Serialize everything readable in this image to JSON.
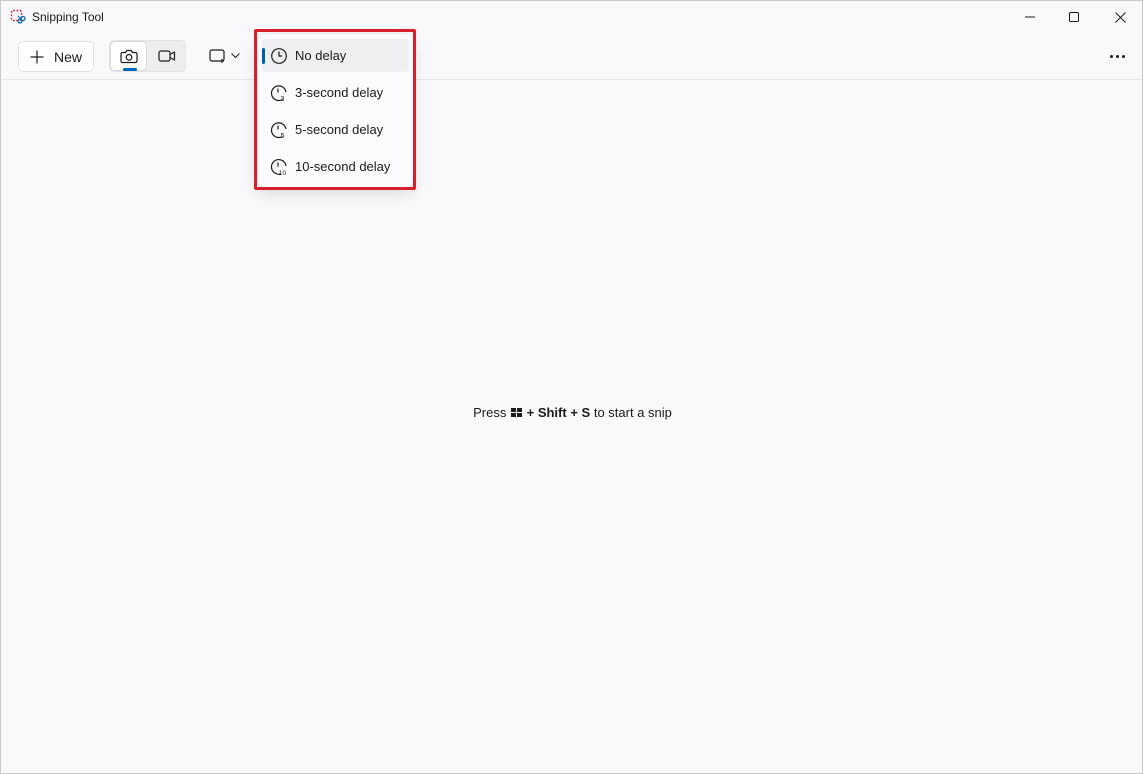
{
  "window": {
    "title": "Snipping Tool",
    "controls": {
      "minimize_icon": "minimize-icon",
      "maximize_icon": "maximize-icon",
      "close_icon": "close-icon"
    }
  },
  "toolbar": {
    "new_label": "New",
    "new_icon": "plus-icon",
    "modes": [
      {
        "name": "screenshot",
        "icon": "camera-icon",
        "selected": true
      },
      {
        "name": "record",
        "icon": "video-camera-icon",
        "selected": false
      }
    ],
    "shape_icon": "rectangle-snip-icon",
    "more_icon": "more-icon"
  },
  "delay_menu": {
    "items": [
      {
        "label": "No delay",
        "icon": "clock-icon",
        "selected": true
      },
      {
        "label": "3-second delay",
        "icon": "timer-3-icon",
        "selected": false
      },
      {
        "label": "5-second delay",
        "icon": "timer-5-icon",
        "selected": false
      },
      {
        "label": "10-second delay",
        "icon": "timer-10-icon",
        "selected": false
      }
    ]
  },
  "hint": {
    "prefix": "Press",
    "plus1": "+",
    "shift": "Shift",
    "plus2": "+",
    "s_key": "S",
    "suffix": "to start a snip"
  },
  "colors": {
    "accent": "#0067c0",
    "highlight_border": "#d8202d",
    "background": "#f9f9fb"
  }
}
